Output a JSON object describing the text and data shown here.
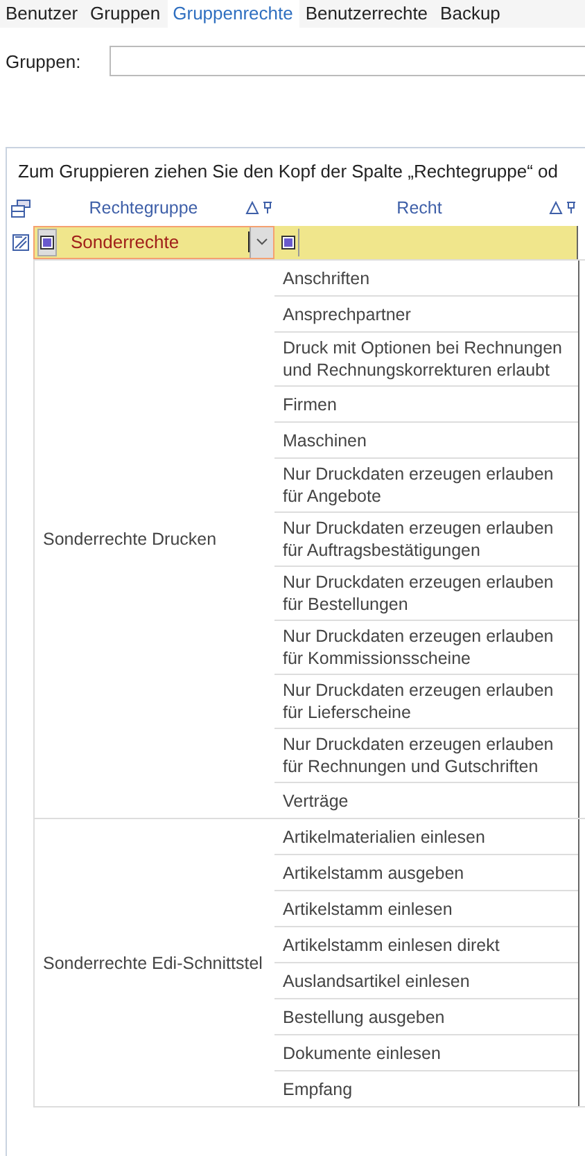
{
  "tabs": [
    {
      "label": "Benutzer",
      "selected": false
    },
    {
      "label": "Gruppen",
      "selected": false
    },
    {
      "label": "Gruppenrechte",
      "selected": true
    },
    {
      "label": "Benutzerrechte",
      "selected": false
    },
    {
      "label": "Backup",
      "selected": false
    }
  ],
  "groups_field": {
    "label": "Gruppen:"
  },
  "grid": {
    "group_hint": "Zum Gruppieren ziehen Sie den Kopf der Spalte „Rechtegruppe“ od",
    "columns": [
      {
        "label": "Rechtegruppe"
      },
      {
        "label": "Recht"
      }
    ],
    "filter_row": {
      "value": "Sonderrechte"
    },
    "groups": [
      {
        "name": "Sonderrechte Drucken",
        "rights": [
          "Anschriften",
          "Ansprechpartner",
          "Druck mit Optionen bei Rechnungen und Rechnungskorrekturen erlaubt",
          "Firmen",
          "Maschinen",
          "Nur Druckdaten erzeugen erlauben für Angebote",
          "Nur Druckdaten erzeugen erlauben für Auftragsbestätigungen",
          "Nur Druckdaten erzeugen erlauben für Bestellungen",
          "Nur Druckdaten erzeugen erlauben für Kommissionsscheine",
          "Nur Druckdaten erzeugen erlauben für Lieferscheine",
          "Nur Druckdaten erzeugen erlauben für Rechnungen und Gutschriften",
          "Verträge"
        ]
      },
      {
        "name": "Sonderrechte Edi-Schnittstel",
        "rights": [
          "Artikelmaterialien einlesen",
          "Artikelstamm ausgeben",
          "Artikelstamm einlesen",
          "Artikelstamm einlesen direkt",
          "Auslandsartikel einlesen",
          "Bestellung ausgeben",
          "Dokumente einlesen",
          "Empfang"
        ]
      }
    ]
  }
}
